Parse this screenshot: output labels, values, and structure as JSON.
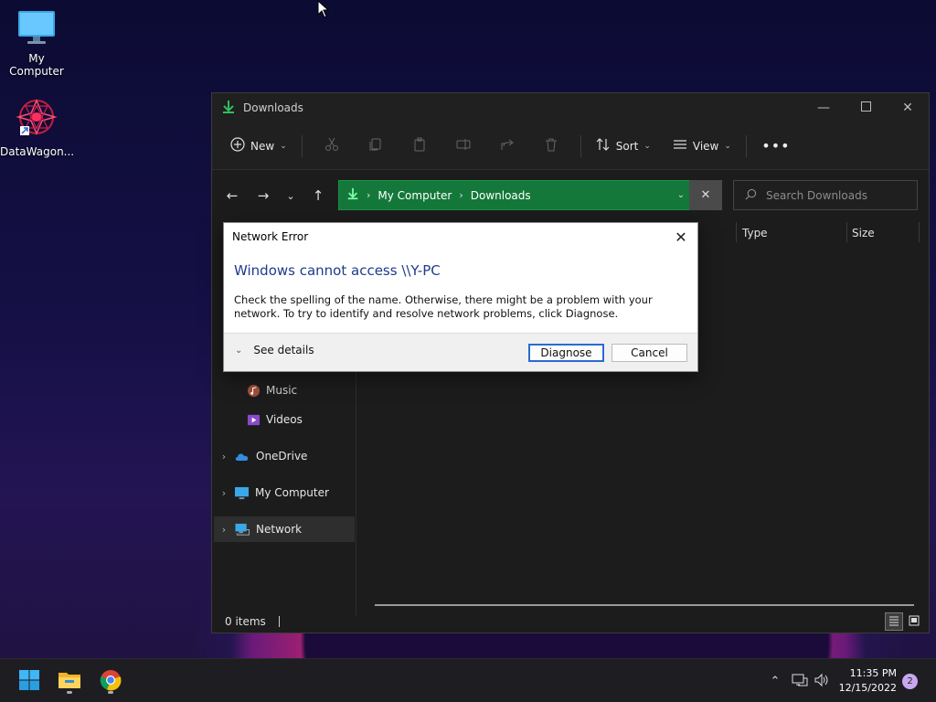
{
  "desktop": {
    "icons": [
      {
        "label": "My Computer"
      },
      {
        "label": "DataWagon..."
      }
    ]
  },
  "explorer": {
    "title": "Downloads",
    "toolbar": {
      "new_label": "New",
      "sort_label": "Sort",
      "view_label": "View"
    },
    "address": {
      "crumbs": [
        "My Computer",
        "Downloads"
      ]
    },
    "search": {
      "placeholder": "Search Downloads"
    },
    "columns": [
      "Type",
      "Size"
    ],
    "sidebar": {
      "items": [
        {
          "label": "Music"
        },
        {
          "label": "Videos"
        },
        {
          "label": "OneDrive"
        },
        {
          "label": "My Computer"
        },
        {
          "label": "Network"
        }
      ]
    },
    "status": {
      "items": "0 items"
    }
  },
  "dialog": {
    "title": "Network Error",
    "heading": "Windows cannot access \\\\Y-PC",
    "message": "Check the spelling of the name. Otherwise, there might be a problem with your network. To try to identify and resolve network problems, click Diagnose.",
    "details_label": "See details",
    "diagnose_label": "Diagnose",
    "cancel_label": "Cancel"
  },
  "taskbar": {
    "time": "11:35 PM",
    "date": "12/15/2022",
    "notification_count": "2"
  },
  "colors": {
    "address_bar": "#14783a",
    "dialog_heading": "#1e3c8c",
    "primary_button_border": "#2a6bd0"
  }
}
